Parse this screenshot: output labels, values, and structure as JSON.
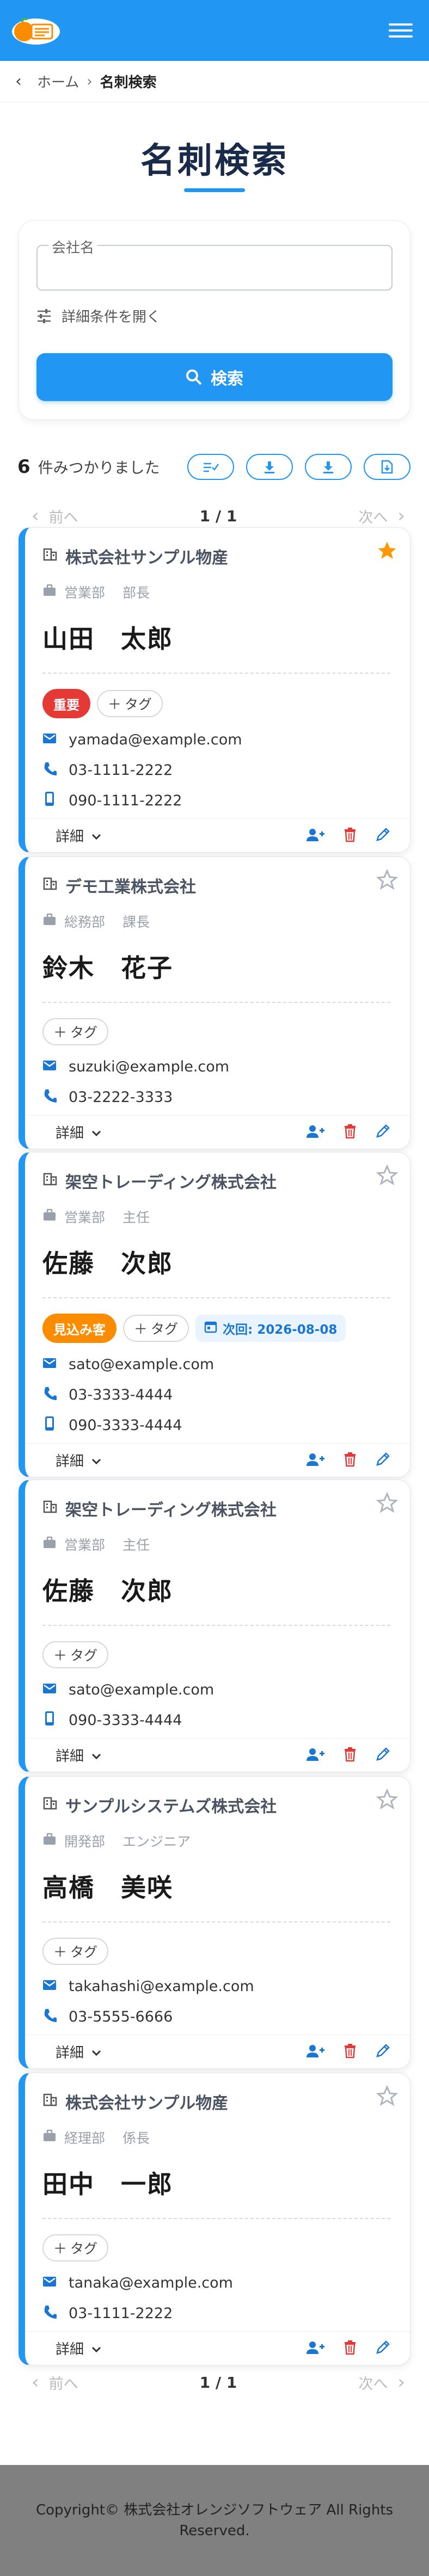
{
  "header": {
    "logo": "card-logo-icon",
    "menu": "hamburger-menu-icon"
  },
  "breadcrumb": {
    "home": "ホーム",
    "separator": "›",
    "current": "名刺検索"
  },
  "page": {
    "title": "名刺検索"
  },
  "search": {
    "company_label": "会社名",
    "company_value": "",
    "advanced_toggle": "詳細条件を開く",
    "button_label": "検索"
  },
  "results": {
    "count": "6",
    "label": "件みつかりました"
  },
  "pager": {
    "prev": "前へ",
    "next": "次へ",
    "page": "1 / 1"
  },
  "cards": [
    {
      "company": "株式会社サンプル物産",
      "dept": "営業部",
      "title": "部長",
      "name": "山田　太郎",
      "starred": true,
      "badge": {
        "label": "重要",
        "color": "#e53935"
      },
      "tag_add": "タグ",
      "next": "",
      "email": "yamada@example.com",
      "phone": "03-1111-2222",
      "mobile": "090-1111-2222",
      "details": "詳細"
    },
    {
      "company": "デモ工業株式会社",
      "dept": "総務部",
      "title": "課長",
      "name": "鈴木　花子",
      "starred": false,
      "badge": null,
      "tag_add": "タグ",
      "next": "",
      "email": "suzuki@example.com",
      "phone": "03-2222-3333",
      "mobile": "",
      "details": "詳細"
    },
    {
      "company": "架空トレーディング株式会社",
      "dept": "営業部",
      "title": "主任",
      "name": "佐藤　次郎",
      "starred": false,
      "badge": {
        "label": "見込み客",
        "color": "#fb8c00"
      },
      "tag_add": "タグ",
      "next": "次回: 2026-08-08",
      "email": "sato@example.com",
      "phone": "03-3333-4444",
      "mobile": "090-3333-4444",
      "details": "詳細"
    },
    {
      "company": "架空トレーディング株式会社",
      "dept": "営業部",
      "title": "主任",
      "name": "佐藤　次郎",
      "starred": false,
      "badge": null,
      "tag_add": "タグ",
      "next": "",
      "email": "sato@example.com",
      "phone": "",
      "mobile": "090-3333-4444",
      "details": "詳細"
    },
    {
      "company": "サンプルシステムズ株式会社",
      "dept": "開発部",
      "title": "エンジニア",
      "name": "高橋　美咲",
      "starred": false,
      "badge": null,
      "tag_add": "タグ",
      "next": "",
      "email": "takahashi@example.com",
      "phone": "03-5555-6666",
      "mobile": "",
      "details": "詳細"
    },
    {
      "company": "株式会社サンプル物産",
      "dept": "経理部",
      "title": "係長",
      "name": "田中　一郎",
      "starred": false,
      "badge": null,
      "tag_add": "タグ",
      "next": "",
      "email": "tanaka@example.com",
      "phone": "03-1111-2222",
      "mobile": "",
      "details": "詳細"
    }
  ],
  "footer": {
    "copyright": "Copyright© 株式会社オレンジソフトウェア All Rights Reserved."
  },
  "colors": {
    "primary": "#2196f3",
    "danger": "#e53935",
    "warning": "#fb8c00",
    "star": "#ff9800"
  }
}
